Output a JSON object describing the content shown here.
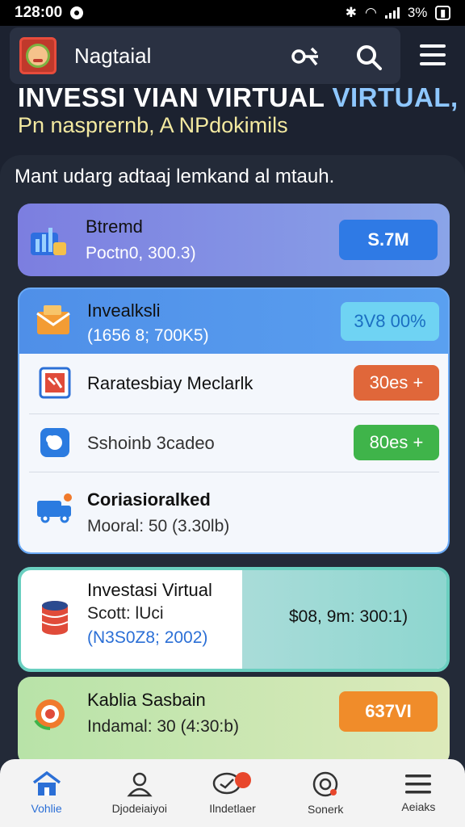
{
  "status_bar": {
    "time": "128:00",
    "battery": "3%"
  },
  "header": {
    "app_name": "Nagtaial"
  },
  "hero": {
    "title_main": "INVESSI VIAN VIRTUAL",
    "title_accent": "VIRTUAL,",
    "subtitle": "Pn  nasprernb, A NPdokimils"
  },
  "intro": "Mant udarg adtaaj lemkand al mtauh.",
  "cards": {
    "c1": {
      "title": "Btremd",
      "sub": "Poctn0, 300.3)",
      "pill": "S.7M"
    },
    "c2": {
      "title": "Invealksli",
      "sub": "(1656 8; 700K5)",
      "pill": "3V8 00%",
      "rows": [
        {
          "title": "Raratesbiay Meclarlk",
          "pill": "30es +"
        },
        {
          "title": "Sshoinb 3cadeo",
          "pill": "80es +"
        },
        {
          "title": "Coriasioralked",
          "sub": "Mooral: 50 (3.30lb)"
        }
      ]
    },
    "c3": {
      "title": "Investasi Virtual",
      "line2": "Scott: lUci",
      "line3": "(N3S0Z8; 2002)",
      "value": "$08, 9m: 300:1)"
    },
    "c4": {
      "title": "Kablia Sasbain",
      "sub": "Indamal: 30 (4:30:b)",
      "pill": "637VI"
    }
  },
  "nav": [
    {
      "label": "Vohlie",
      "icon": "home-icon"
    },
    {
      "label": "Djodeiaiyoi",
      "icon": "user-icon"
    },
    {
      "label": "Ilndetlaer",
      "icon": "chat-icon"
    },
    {
      "label": "Sonerk",
      "icon": "gear-icon"
    },
    {
      "label": "Aeiaks",
      "icon": "menu-icon"
    }
  ],
  "colors": {
    "accent": "#2b6fd6",
    "orange": "#e8762c",
    "green": "#3fb44a"
  }
}
